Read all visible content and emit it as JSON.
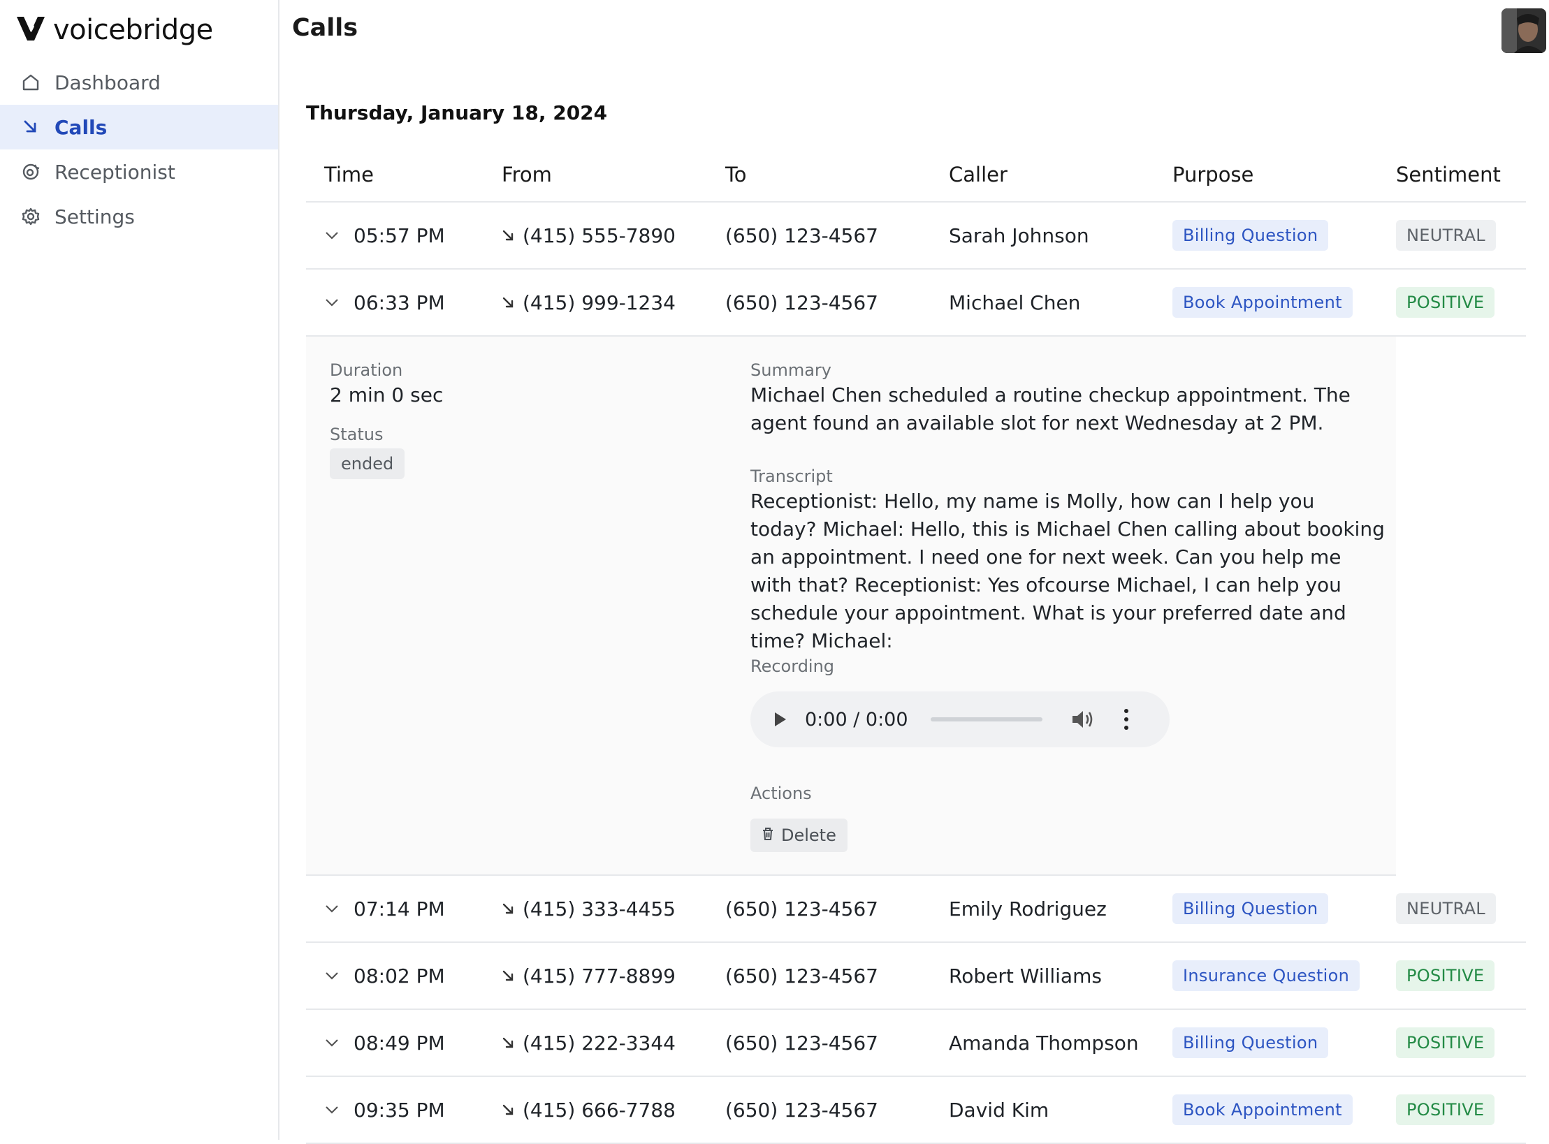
{
  "brand": {
    "name": "voicebridge"
  },
  "sidebar": {
    "items": [
      {
        "label": "Dashboard",
        "icon": "home-icon",
        "active": false
      },
      {
        "label": "Calls",
        "icon": "incoming-call-icon",
        "active": true
      },
      {
        "label": "Receptionist",
        "icon": "receptionist-icon",
        "active": false
      },
      {
        "label": "Settings",
        "icon": "gear-icon",
        "active": false
      }
    ]
  },
  "header": {
    "title": "Calls"
  },
  "colors": {
    "accent": "#2249b8",
    "active_bg": "#e8eefb",
    "positive": "#238a45",
    "neutral": "#5e6369"
  },
  "main": {
    "date_heading": "Thursday, January 18, 2024",
    "columns": [
      "Time",
      "From",
      "To",
      "Caller",
      "Purpose",
      "Sentiment"
    ],
    "rows": [
      {
        "time": "05:57 PM",
        "from": "(415) 555-7890",
        "to": "(650) 123-4567",
        "caller": "Sarah Johnson",
        "purpose": "Billing Question",
        "sentiment": "NEUTRAL"
      },
      {
        "time": "06:33 PM",
        "from": "(415) 999-1234",
        "to": "(650) 123-4567",
        "caller": "Michael Chen",
        "purpose": "Book Appointment",
        "sentiment": "POSITIVE"
      },
      {
        "time": "07:14 PM",
        "from": "(415) 333-4455",
        "to": "(650) 123-4567",
        "caller": "Emily Rodriguez",
        "purpose": "Billing Question",
        "sentiment": "NEUTRAL"
      },
      {
        "time": "08:02 PM",
        "from": "(415) 777-8899",
        "to": "(650) 123-4567",
        "caller": "Robert Williams",
        "purpose": "Insurance Question",
        "sentiment": "POSITIVE"
      },
      {
        "time": "08:49 PM",
        "from": "(415) 222-3344",
        "to": "(650) 123-4567",
        "caller": "Amanda Thompson",
        "purpose": "Billing Question",
        "sentiment": "POSITIVE"
      },
      {
        "time": "09:35 PM",
        "from": "(415) 666-7788",
        "to": "(650) 123-4567",
        "caller": "David Kim",
        "purpose": "Book Appointment",
        "sentiment": "POSITIVE"
      }
    ],
    "detail": {
      "duration_label": "Duration",
      "duration_value": "2 min 0 sec",
      "status_label": "Status",
      "status_value": "ended",
      "summary_label": "Summary",
      "summary_text": "Michael Chen scheduled a routine checkup appointment. The agent found an available slot for next Wednesday at 2 PM.",
      "transcript_label": "Transcript",
      "transcript_text": "Receptionist: Hello, my name is Molly, how can I help you today? Michael: Hello, this is Michael Chen calling about booking an appointment. I need one for next week. Can you help me with that? Receptionist: Yes ofcourse Michael, I can help you schedule your appointment. What is your preferred date and time? Michael:",
      "recording_label": "Recording",
      "recording_time": "0:00 / 0:00",
      "actions_label": "Actions",
      "delete_label": "Delete"
    }
  }
}
